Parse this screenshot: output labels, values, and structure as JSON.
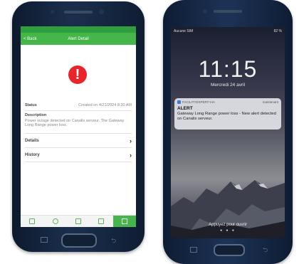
{
  "android": {
    "status_left": "",
    "status_right": "",
    "appbar": {
      "back_label": "< Back",
      "title": "Alert Detail"
    },
    "alert_icon": "!",
    "status_label": "Status",
    "status_value": "Created on 4/21/2024 8:30 AM",
    "description_label": "Description",
    "description_value": "Power outage detected on Canalis serveur. The Gateway Long Range power loss.",
    "details_label": "Details",
    "history_label": "History",
    "tabs": [
      "home-icon",
      "chat-icon",
      "file-icon",
      "chart-icon",
      "settings-icon"
    ]
  },
  "iphone": {
    "status_left": "Aucune SIM",
    "status_right": "82 %",
    "time": "11:15",
    "date": "Mercredi 24 avril",
    "notification": {
      "app_name": "FACILITYEXPERT-VIA",
      "when": "maintenant",
      "title": "ALERT",
      "body": "Gateway Long Range power loss - New alert detected on Canalis serveur."
    },
    "unlock_hint": "Appuyez pour ouvrir",
    "page_dots": "● ● ●"
  },
  "colors": {
    "accent_green": "#45b649",
    "alert_red": "#e8252b"
  }
}
